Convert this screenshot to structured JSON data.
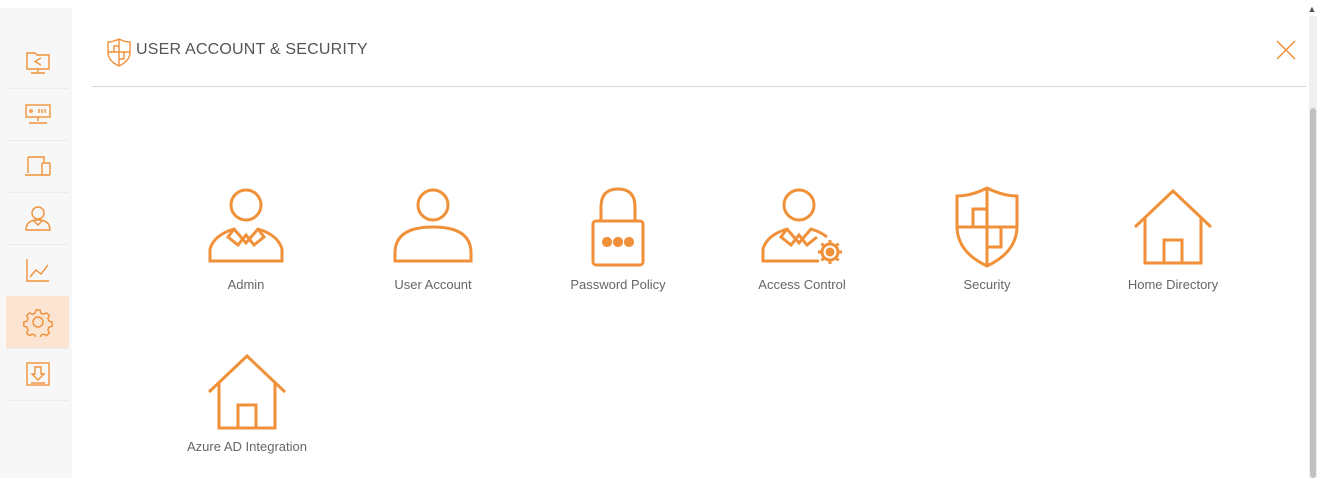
{
  "header": {
    "title": "USER ACCOUNT & SECURITY"
  },
  "sidebar": {
    "items": [
      {
        "icon": "folder-share-icon"
      },
      {
        "icon": "network-storage-icon"
      },
      {
        "icon": "devices-icon"
      },
      {
        "icon": "user-icon"
      },
      {
        "icon": "chart-icon"
      },
      {
        "icon": "gear-icon",
        "active": true
      },
      {
        "icon": "download-icon"
      }
    ]
  },
  "tiles": [
    {
      "label": "Admin",
      "icon": "admin-icon"
    },
    {
      "label": "User Account",
      "icon": "user-account-icon"
    },
    {
      "label": "Password Policy",
      "icon": "lock-icon"
    },
    {
      "label": "Access Control",
      "icon": "access-control-icon"
    },
    {
      "label": "Security",
      "icon": "shield-icon"
    },
    {
      "label": "Home Directory",
      "icon": "home-icon"
    },
    {
      "label": "Azure AD Integration",
      "icon": "home-icon"
    }
  ],
  "colors": {
    "accent": "#f0913a",
    "active_bg": "#fbe4d2",
    "sidebar_bg": "#f7f7f7",
    "text": "#666666"
  }
}
